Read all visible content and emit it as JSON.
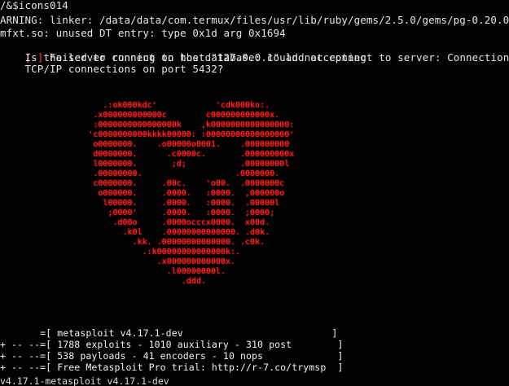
{
  "terminal": {
    "top_lines": [
      "/&$icons014",
      "ARNING: linker: /data/data/com.termux/files/usr/lib/ruby/gems/2.5.0/gems/pg-0.20.0/lib/psection re",
      "mfxt.so: unused DT entry: type 0x1d arg 0x1694",
      " Failed to connect to the database: could not connect to server: Connection refused",
      "    Is the server running on host \"127.0.0.1\" and accepting",
      "    TCP/IP connections on port 5432?"
    ],
    "error_prefix": "[-]",
    "heart_rows": [
      "                     .:ok000kdc'            'cdk000ko:.",
      "                   .x000000000000c        c000000000000x.",
      "                   :0000000000000000k    ,k0000000000000000:",
      "                  'c0000000000kkkk00000: :00000000000000000'",
      "                   o0000000.    .o00000o0001.    .000000000",
      "                   d0000000.      .c0000c.       .000000000x",
      "                   l0000000.       ;d;           .00000000l",
      "                   .00000000.                   .0000000.",
      "                   c0000000.     .00c.    'o00.  .0000000c",
      "                    o000000.     .0000.   :0000.  ,000000o",
      "                     l00000.     .0000.   :0000.  .00000l",
      "                      ;0000'     .0000.   :0000.  ;0000;",
      "                       .d00o     .0000occcx0000.  x00d.",
      "                         .k0l    .00000000000000. .d0k.",
      "                           .kk. .00000000000000. .c0k.",
      "                             .:k00000000000000k:.",
      "                                .x000000000000x.",
      "                                  .l00000000l.",
      "                                     .ddd."
    ],
    "banner": [
      "       =[ metasploit v4.17.1-dev                          ]",
      "+ -- --=[ 1788 exploits - 1010 auxiliary - 310 post        ]",
      "+ -- --=[ 538 payloads - 41 encoders - 10 nops             ]",
      "+ -- --=[ Free Metasploit Pro trial: http://r-7.co/trymsp  ]"
    ],
    "bottom_line": "v4.17.1-metasploit v4.17.1-dev",
    "colors": {
      "background": "#020202",
      "text": "#e6e6e6",
      "heart": "#ff2b2b",
      "error": "#ff3a3a"
    }
  }
}
